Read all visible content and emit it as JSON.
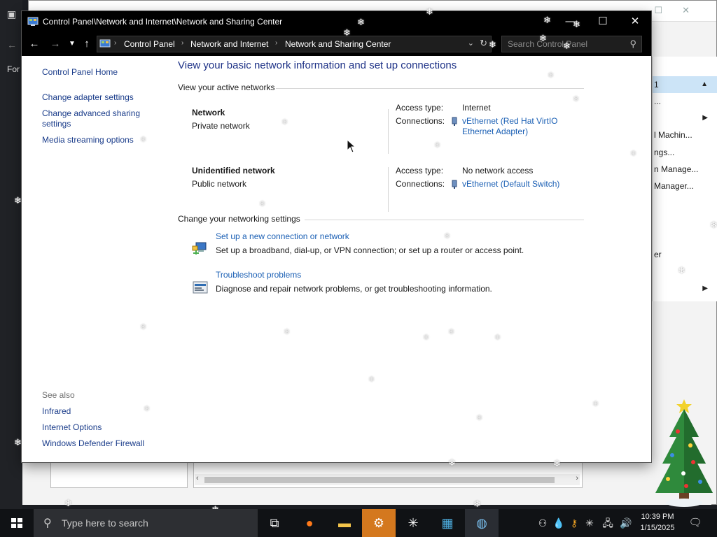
{
  "background": {
    "left_label": "For",
    "right_panel": {
      "items": [
        "1",
        "...",
        "l Machin...",
        "ngs...",
        "n Manage...",
        "Manager...",
        "er"
      ]
    }
  },
  "window": {
    "title": "Control Panel\\Network and Internet\\Network and Sharing Center",
    "breadcrumbs": [
      "Control Panel",
      "Network and Internet",
      "Network and Sharing Center"
    ],
    "search_placeholder": "Search Control Panel"
  },
  "sidebar": {
    "home": "Control Panel Home",
    "links": [
      "Change adapter settings",
      "Change advanced sharing settings",
      "Media streaming options"
    ],
    "see_also_label": "See also",
    "see_also": [
      "Infrared",
      "Internet Options",
      "Windows Defender Firewall"
    ]
  },
  "main": {
    "heading": "View your basic network information and set up connections",
    "active_networks_title": "View your active networks",
    "networks": [
      {
        "name": "Network",
        "category": "Private network",
        "access_label": "Access type:",
        "access_value": "Internet",
        "connections_label": "Connections:",
        "connection_line1": "vEthernet (Red Hat VirtIO",
        "connection_line2": "Ethernet Adapter)"
      },
      {
        "name": "Unidentified network",
        "category": "Public network",
        "access_label": "Access type:",
        "access_value": "No network access",
        "connections_label": "Connections:",
        "connection_line1": "vEthernet (Default Switch)"
      }
    ],
    "change_settings_title": "Change your networking settings",
    "settings": [
      {
        "link": "Set up a new connection or network",
        "desc": "Set up a broadband, dial-up, or VPN connection; or set up a router or access point."
      },
      {
        "link": "Troubleshoot problems",
        "desc": "Diagnose and repair network problems, or get troubleshooting information."
      }
    ]
  },
  "taskbar": {
    "search_placeholder": "Type here to search",
    "time": "10:39 PM",
    "date": "1/15/2025"
  },
  "colors": {
    "link": "#1a5fb4",
    "heading": "#1e3287",
    "active_app": "#d4781e"
  }
}
